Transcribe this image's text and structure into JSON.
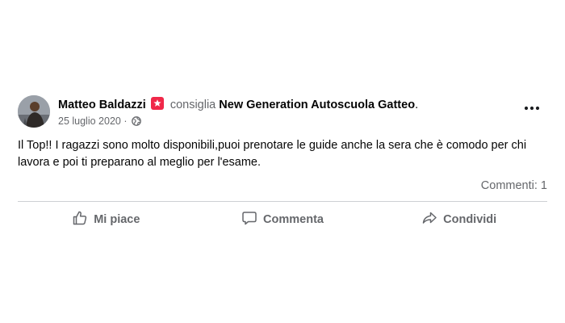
{
  "post": {
    "author": "Matteo Baldazzi",
    "recommends_text": "consiglia",
    "page_name": "New Generation Autoscuola Gatteo",
    "date": "25 luglio 2020 ·",
    "body": "Il Top!! I ragazzi sono molto disponibili,puoi prenotare le guide anche la sera che è comodo per chi lavora e poi ti preparano al meglio per l'esame.",
    "comments_count": "Commenti: 1"
  },
  "actions": {
    "like": "Mi piace",
    "comment": "Commenta",
    "share": "Condividi"
  },
  "icons": {
    "recommend_badge": "recommend-star-icon",
    "audience": "globe-icon",
    "more": "more-options-icon",
    "like": "thumbs-up-icon",
    "comment": "comment-bubble-icon",
    "share": "share-arrow-icon"
  },
  "colors": {
    "recommend_badge": "#f02849",
    "secondary_text": "#65676b",
    "divider": "#ced0d4"
  }
}
